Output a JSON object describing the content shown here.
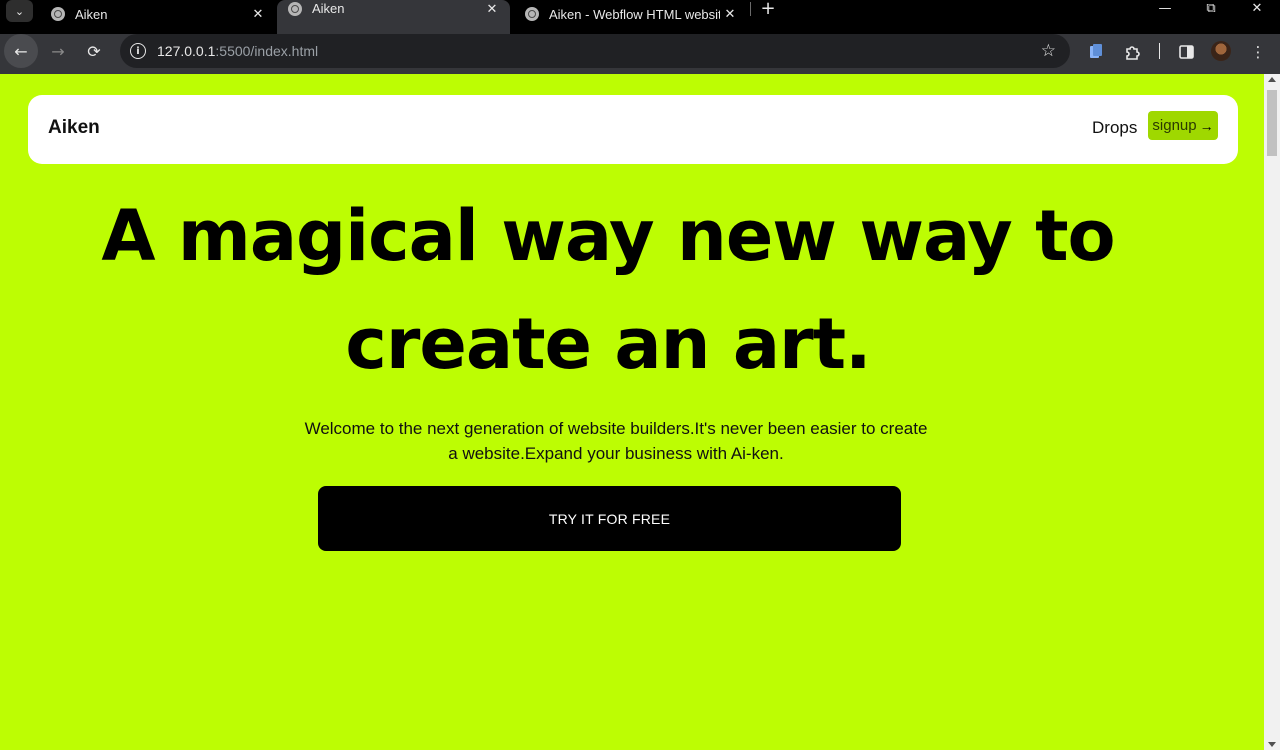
{
  "browser": {
    "tabs": [
      {
        "title": "Aiken",
        "active": false
      },
      {
        "title": "Aiken",
        "active": true
      },
      {
        "title": "Aiken - Webflow HTML website",
        "active": false
      }
    ],
    "url_host": "127.0.0.1",
    "url_path": ":5500/index.html"
  },
  "site": {
    "brand": "Aiken",
    "nav_link": "Drops",
    "signup_label": "signup",
    "headline_line1": "A magical way new way to",
    "headline_line2": "create an art.",
    "subtext": "Welcome to the next generation of website builders.It's never been easier to create a website.Expand your business with Ai-ken.",
    "cta_label": "TRY IT FOR FREE"
  },
  "colors": {
    "page_background": "#bdfd03",
    "signup_background": "#9fd800",
    "cta_background": "#000000"
  }
}
